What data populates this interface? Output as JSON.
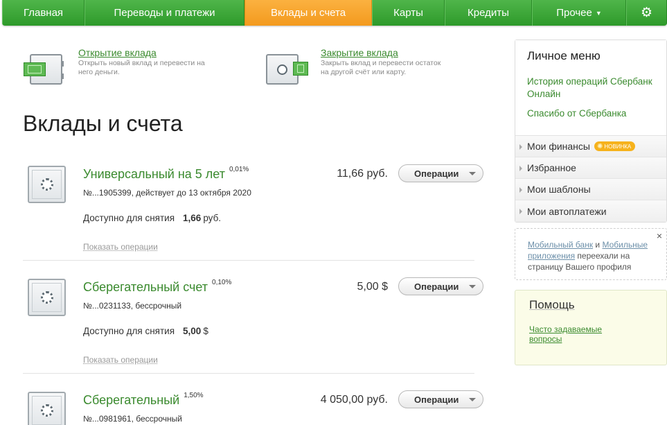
{
  "nav": {
    "items": [
      {
        "label": "Главная"
      },
      {
        "label": "Переводы и платежи"
      },
      {
        "label": "Вклады и счета"
      },
      {
        "label": "Карты"
      },
      {
        "label": "Кредиты"
      },
      {
        "label": "Прочее"
      }
    ],
    "settings_icon": "gear-icon"
  },
  "actions": {
    "open": {
      "title": "Открытие вклада",
      "desc": "Открыть новый вклад и перевести на него деньги."
    },
    "close": {
      "title": "Закрытие вклада",
      "desc": "Закрыть вклад и перевести остаток на другой счёт или карту."
    }
  },
  "page_title": "Вклады и счета",
  "deposits": [
    {
      "name": "Универсальный на 5 лет",
      "rate": "0,01%",
      "meta": "№...1905399, действует до 13 октября 2020",
      "amount": "11,66 руб.",
      "avail_label": "Доступно для снятия",
      "avail_value": "1,66",
      "avail_currency": "руб.",
      "ops": "Операции",
      "show": "Показать операции"
    },
    {
      "name": "Сберегательный счет",
      "rate": "0,10%",
      "meta": "№...0231133, бессрочный",
      "amount": "5,00 $",
      "avail_label": "Доступно для снятия",
      "avail_value": "5,00",
      "avail_currency": "$",
      "ops": "Операции",
      "show": "Показать операции"
    },
    {
      "name": "Сберегательный",
      "rate": "1,50%",
      "meta": "№...0981961, бессрочный",
      "amount": "4 050,00 руб.",
      "ops": "Операции"
    }
  ],
  "sidebar": {
    "title": "Личное меню",
    "links": [
      "История операций Сбербанк Онлайн",
      "Спасибо от Сбербанка"
    ],
    "rows": [
      {
        "label": "Мои финансы",
        "badge": "НОВИНКА"
      },
      {
        "label": "Избранное"
      },
      {
        "label": "Мои шаблоны"
      },
      {
        "label": "Мои автоплатежи"
      }
    ],
    "notice": {
      "link1": "Мобильный банк",
      "and": " и ",
      "link2": "Мобильные приложения",
      "text": " переехали на страницу Вашего профиля",
      "close": "×"
    },
    "help": {
      "title": "Помощь",
      "link": "Часто задаваемые вопросы"
    }
  },
  "colors": {
    "nav_green": "#3aa535",
    "nav_active": "#f5a229",
    "link_green": "#3a8a2e"
  }
}
